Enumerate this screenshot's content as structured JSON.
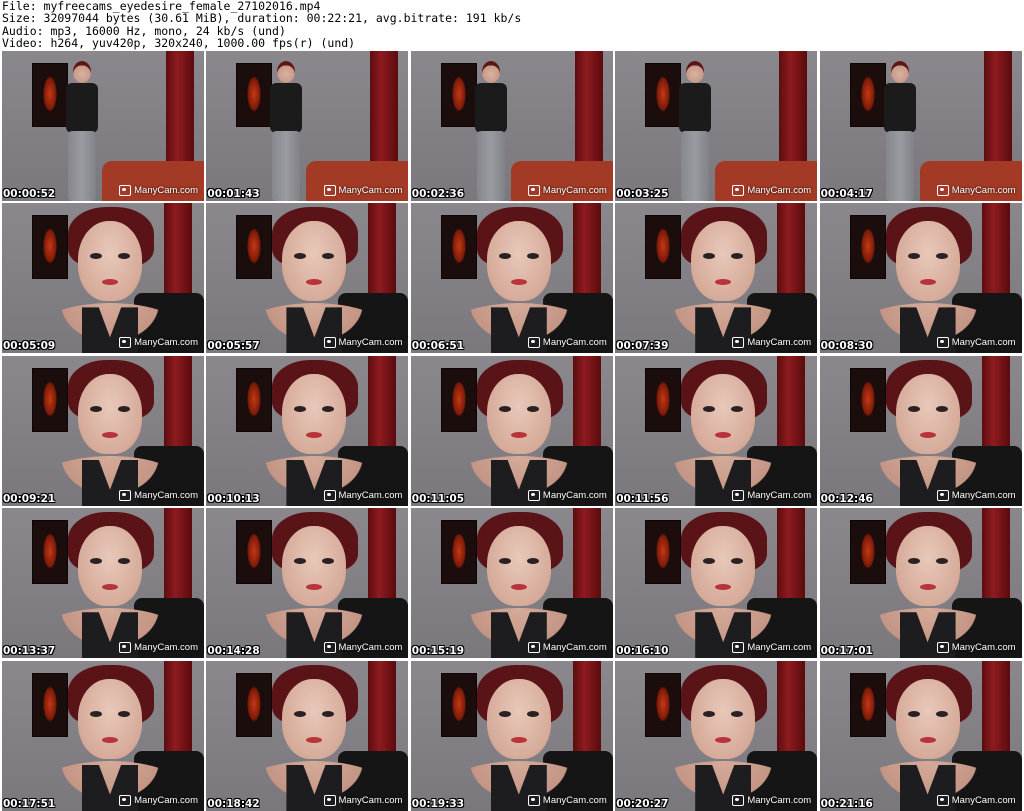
{
  "header": {
    "file_line": "File: myfreecams_eyedesire_female_27102016.mp4",
    "size_line": "Size: 32097044 bytes (30.61 MiB), duration: 00:22:21, avg.bitrate: 191 kb/s",
    "audio_line": "Audio: mp3, 16000 Hz, mono, 24 kb/s (und)",
    "video_line": "Video: h264, yuv420p, 320x240, 1000.00 fps(r) (und)"
  },
  "watermark": "ManyCam.com",
  "thumbnails": [
    {
      "time": "00:00:52",
      "scene": "standing"
    },
    {
      "time": "00:01:43",
      "scene": "standing"
    },
    {
      "time": "00:02:36",
      "scene": "standing"
    },
    {
      "time": "00:03:25",
      "scene": "standing"
    },
    {
      "time": "00:04:17",
      "scene": "standing"
    },
    {
      "time": "00:05:09",
      "scene": "closeup"
    },
    {
      "time": "00:05:57",
      "scene": "closeup"
    },
    {
      "time": "00:06:51",
      "scene": "closeup"
    },
    {
      "time": "00:07:39",
      "scene": "closeup"
    },
    {
      "time": "00:08:30",
      "scene": "closeup"
    },
    {
      "time": "00:09:21",
      "scene": "closeup"
    },
    {
      "time": "00:10:13",
      "scene": "closeup"
    },
    {
      "time": "00:11:05",
      "scene": "closeup"
    },
    {
      "time": "00:11:56",
      "scene": "closeup"
    },
    {
      "time": "00:12:46",
      "scene": "closeup"
    },
    {
      "time": "00:13:37",
      "scene": "closeup"
    },
    {
      "time": "00:14:28",
      "scene": "closeup"
    },
    {
      "time": "00:15:19",
      "scene": "closeup"
    },
    {
      "time": "00:16:10",
      "scene": "closeup"
    },
    {
      "time": "00:17:01",
      "scene": "closeup"
    },
    {
      "time": "00:17:51",
      "scene": "closeup"
    },
    {
      "time": "00:18:42",
      "scene": "closeup"
    },
    {
      "time": "00:19:33",
      "scene": "closeup"
    },
    {
      "time": "00:20:27",
      "scene": "closeup"
    },
    {
      "time": "00:21:16",
      "scene": "closeup"
    }
  ]
}
